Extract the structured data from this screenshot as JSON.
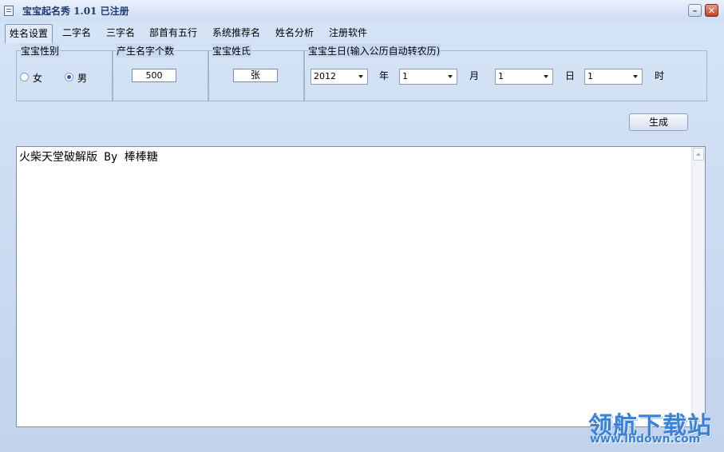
{
  "window": {
    "title": "宝宝起名秀 1.01 已注册",
    "minimize_label": "–",
    "close_label": "✕"
  },
  "tabs": [
    {
      "label": "姓名设置",
      "active": true
    },
    {
      "label": "二字名"
    },
    {
      "label": "三字名"
    },
    {
      "label": "部首有五行"
    },
    {
      "label": "系统推荐名"
    },
    {
      "label": "姓名分析"
    },
    {
      "label": "注册软件"
    }
  ],
  "settings": {
    "gender": {
      "title": "宝宝性别",
      "options": [
        {
          "label": "女",
          "checked": false
        },
        {
          "label": "男",
          "checked": true
        }
      ]
    },
    "name_count": {
      "title": "产生名字个数",
      "value": "500"
    },
    "surname": {
      "title": "宝宝姓氏",
      "value": "张"
    },
    "birthday": {
      "title": "宝宝生日(输入公历自动转农历)",
      "year": {
        "value": "2012",
        "unit": "年"
      },
      "month": {
        "value": "1",
        "unit": "月"
      },
      "day": {
        "value": "1",
        "unit": "日"
      },
      "hour": {
        "value": "1",
        "unit": "时"
      }
    }
  },
  "generate_button": "生成",
  "output_text": "火柴天堂破解版 By 棒棒糖",
  "watermark": {
    "main": "领航下载站",
    "url": "www.lhdown.com"
  },
  "colors": {
    "window_bg": "#c4d6ee",
    "title_text": "#1f3b73",
    "close_button": "#c0432a",
    "watermark": "#3b82d6"
  }
}
